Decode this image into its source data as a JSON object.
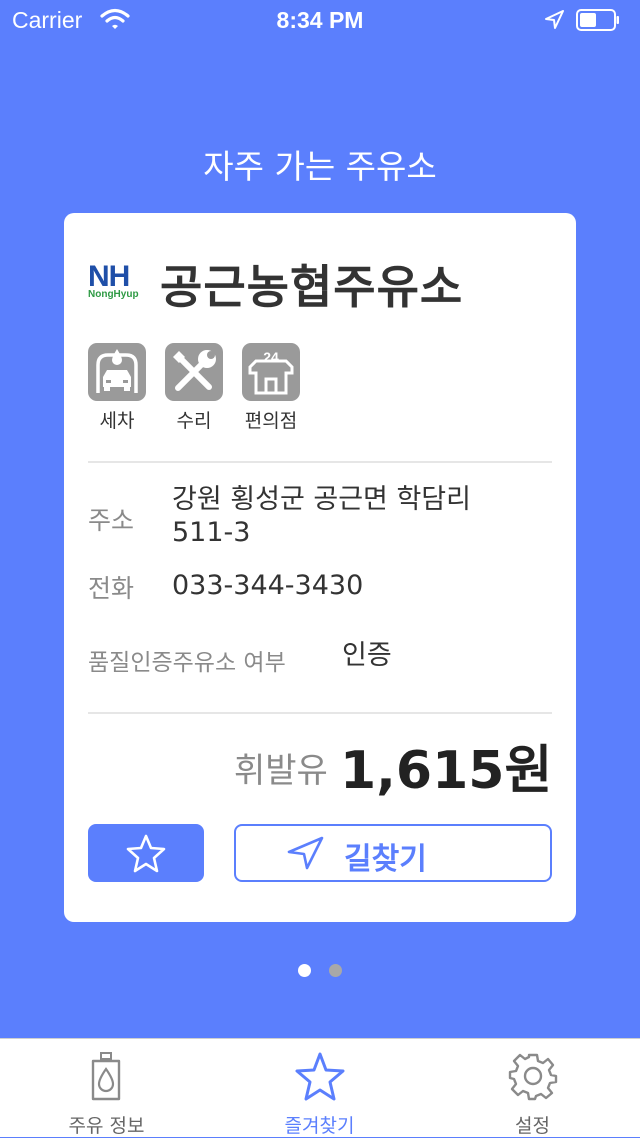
{
  "status_bar": {
    "carrier": "Carrier",
    "time": "8:34 PM"
  },
  "page": {
    "title": "자주 가는 주유소"
  },
  "station": {
    "brand_logo": "NH",
    "brand_sub": "NongHyup",
    "name": "공근농협주유소",
    "services": [
      {
        "label": "세차",
        "icon": "car-wash-icon"
      },
      {
        "label": "수리",
        "icon": "repair-tools-icon"
      },
      {
        "label": "편의점",
        "icon": "convenience-store-24-icon"
      }
    ],
    "address_label": "주소",
    "address_line1": "강원 횡성군 공근면 학담리",
    "address_line2": "511-3",
    "phone_label": "전화",
    "phone": "033-344-3430",
    "quality_label": "품질인증주유소 여부",
    "quality_value": "인증",
    "fuel_type": "휘발유",
    "price": "1,615원"
  },
  "actions": {
    "route_label": "길찾기"
  },
  "pagination": {
    "total": 2,
    "current": 1
  },
  "tabs": [
    {
      "label": "주유 정보",
      "icon": "fuel-icon",
      "active": false
    },
    {
      "label": "즐겨찾기",
      "icon": "star-icon",
      "active": true
    },
    {
      "label": "설정",
      "icon": "gear-icon",
      "active": false
    }
  ],
  "colors": {
    "accent": "#5b7ffd",
    "service_icon_bg": "#9a9a9a",
    "inactive": "#8a8a8a"
  }
}
